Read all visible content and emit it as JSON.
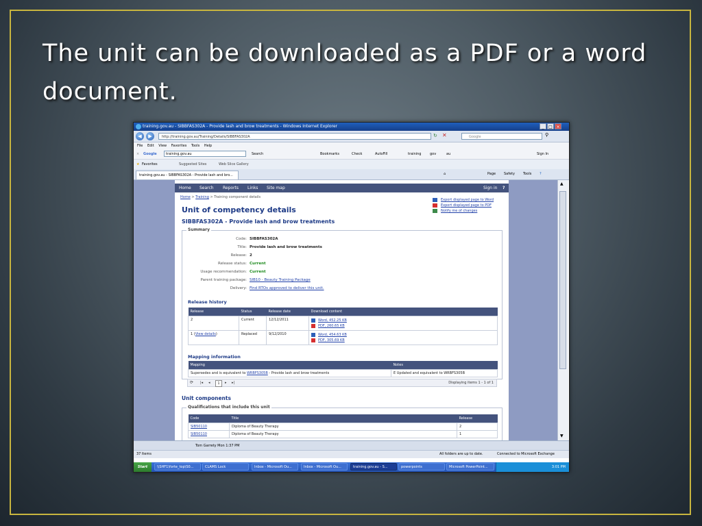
{
  "slide": {
    "title": "The unit can be downloaded as a PDF or a word document."
  },
  "browser": {
    "window_title": "training.gov.au - SIBBFAS302A - Provide lash and brow treatments - Windows Internet Explorer",
    "url": "http://training.gov.au/Training/Details/SIBBFAS302A",
    "search_placeholder": "Google",
    "menu": [
      "File",
      "Edit",
      "View",
      "Favorites",
      "Tools",
      "Help"
    ],
    "google_bar": {
      "search_value": "training.gov.au",
      "items": [
        "Search",
        "Bookmarks",
        "Check",
        "AutoFill",
        "training",
        "gov",
        "au"
      ],
      "sign_in": "Sign In"
    },
    "favorites": {
      "label": "Favorites",
      "items": [
        "Suggested Sites",
        "Web Slice Gallery"
      ]
    },
    "tab_title": "training.gov.au - SIBBFAS302A - Provide lash and bro...",
    "command_bar": [
      "Page",
      "Safety",
      "Tools"
    ]
  },
  "site": {
    "nav": [
      "Home",
      "Search",
      "Reports",
      "Links",
      "Site map"
    ],
    "sign_in": "Sign in",
    "help": "?",
    "breadcrumb": {
      "home": "Home",
      "training": "Training",
      "current": "Training component details"
    },
    "exports": [
      "Export displayed page to Word",
      "Export displayed page to PDF",
      "Notify me of changes"
    ],
    "heading": "Unit of competency details",
    "unit_heading": "SIBBFAS302A - Provide lash and brow treatments",
    "summary": {
      "legend": "Summary",
      "rows": [
        {
          "label": "Code:",
          "value": "SIBBFAS302A"
        },
        {
          "label": "Title:",
          "value": "Provide lash and brow treatments"
        },
        {
          "label": "Release:",
          "value": "2"
        },
        {
          "label": "Release status:",
          "value": "Current"
        },
        {
          "label": "Usage recommendation:",
          "value": "Current"
        },
        {
          "label": "Parent training package:",
          "value": "SIB10 - Beauty Training Package"
        },
        {
          "label": "Delivery:",
          "value": "Find RTOs approved to deliver this unit."
        }
      ]
    },
    "release_history": {
      "title": "Release history",
      "headers": [
        "Release",
        "Status",
        "Release date",
        "Download content"
      ],
      "rows": [
        {
          "release": "2",
          "view": "",
          "status": "Current",
          "date": "12/12/2011",
          "word": "Word, 452.25 KB",
          "pdf": "PDF, 260.65 KB"
        },
        {
          "release": "1 (",
          "view": "View details",
          "view_close": ")",
          "status": "Replaced",
          "date": "9/12/2010",
          "word": "Word, 454.63 KB",
          "pdf": "PDF, 305.69 KB"
        }
      ]
    },
    "mapping": {
      "title": "Mapping information",
      "headers": [
        "Mapping",
        "Notes"
      ],
      "row": {
        "link": "WRBFS305B",
        "pre": "Supersedes and is equivalent to ",
        "post": " - Provide lash and brow treatments",
        "notes": "E Updated and equivalent to WRBFS305B"
      },
      "pager": {
        "page": "1",
        "display": "Displaying items 1 - 1 of 1"
      }
    },
    "components": {
      "title": "Unit components",
      "legend": "Qualifications that include this unit",
      "headers": [
        "Code",
        "Title",
        "Release"
      ],
      "rows": [
        {
          "code": "SIB50110",
          "title": "Diploma of Beauty Therapy",
          "release": "2"
        },
        {
          "code": "SIB50110",
          "title": "Diploma of Beauty Therapy",
          "release": "1"
        }
      ]
    }
  },
  "outlook": {
    "item_count": "37 Items",
    "row": "Tom Garrety      Mon 1:37 PM",
    "status": "All folders are up to date.",
    "exchange": "Connected to Microsoft Exchange"
  },
  "taskbar": {
    "start": "Start",
    "items": [
      "\\\\SHF1\\forte_top\\S0...",
      "CLAMS Lock",
      "Inbox - Microsoft Ou...",
      "Inbox - Microsoft Ou...",
      "training.gov.au - S...",
      "powerpoints",
      "Microsoft PowerPoint..."
    ],
    "time": "3:01 PM"
  },
  "colors": {
    "frame": "#c9b63f",
    "site_nav": "#44537d",
    "heading": "#1d3a86",
    "link": "#1f3fa8",
    "current_status": "#1d8a1d"
  }
}
